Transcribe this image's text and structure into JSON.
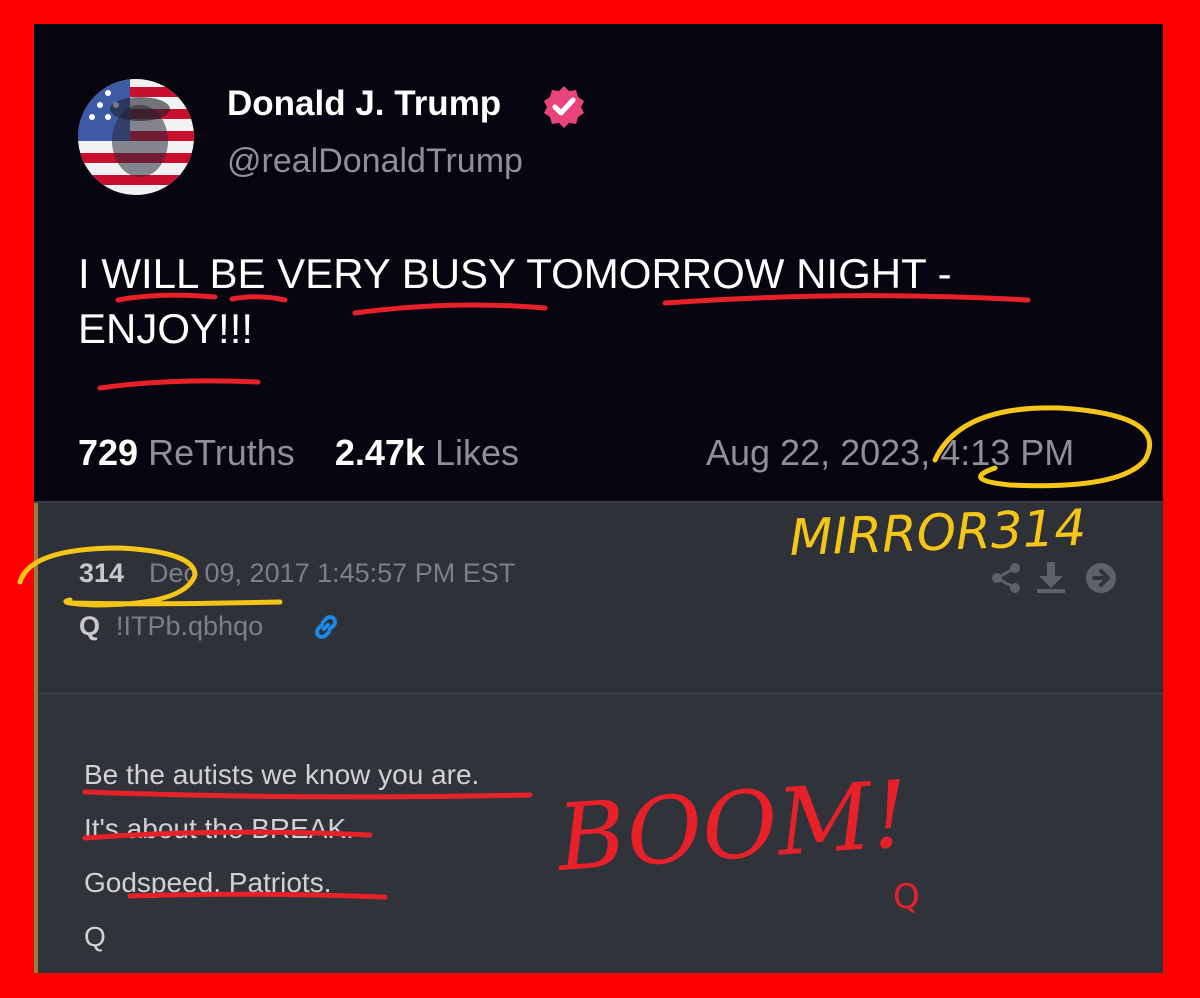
{
  "truth_post": {
    "display_name": "Donald J. Trump",
    "handle": "@realDonaldTrump",
    "text_line1": "I WILL BE VERY BUSY TOMORROW NIGHT -",
    "text_line2": "ENJOY!!!",
    "retruths_count": "729",
    "retruths_label": "ReTruths",
    "likes_count": "2.47k",
    "likes_label": "Likes",
    "date": "Aug 22, 2023, 4:13 PM"
  },
  "q_post": {
    "post_number": "314",
    "date": "Dec 09, 2017 1:45:57 PM EST",
    "author": "Q",
    "tripcode": "!ITPb.qbhqo",
    "body": [
      "Be the autists we know you are.",
      "It's about the BREAK.",
      "Godspeed, Patriots.",
      "Q"
    ]
  },
  "annotations": {
    "mirror_text": "MIRROR314",
    "boom_text": "BOOM!",
    "boom_sub": "Q"
  },
  "colors": {
    "frame_red": "#ff0000",
    "highlight_yellow": "#f5c518",
    "underline_red": "#e8202a",
    "verified_pink": "#e8437a",
    "link_blue": "#1e88e5"
  }
}
